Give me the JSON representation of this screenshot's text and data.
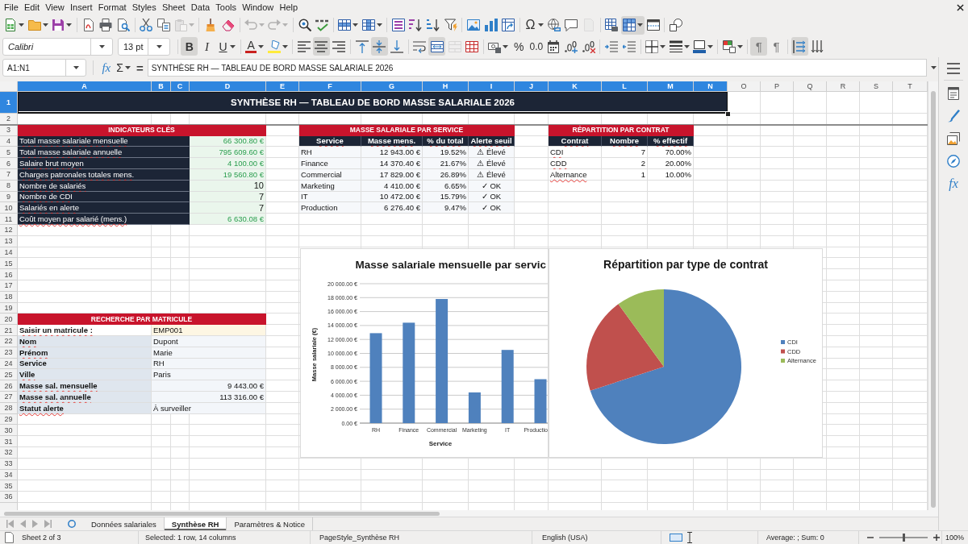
{
  "menu_bar": [
    "File",
    "Edit",
    "View",
    "Insert",
    "Format",
    "Styles",
    "Sheet",
    "Data",
    "Tools",
    "Window",
    "Help"
  ],
  "standard_toolbar": {
    "paste": {
      "disabled": true
    },
    "undo": {
      "disabled": true
    },
    "redo": {
      "disabled": true
    },
    "special_character": {
      "label": "Ω"
    },
    "header_footer": {
      "disabled": true
    },
    "freeze_cells": {
      "pressed": true
    }
  },
  "formatting_toolbar": {
    "font_name": "Calibri",
    "font_size": "13 pt",
    "bold": {
      "label": "B",
      "pressed": true
    },
    "italic": {
      "label": "I",
      "pressed": false
    },
    "underline": {
      "label": "U",
      "pressed": false
    },
    "font_color": {
      "label": "A"
    },
    "align_left": {
      "pressed": false
    },
    "align_center": {
      "pressed": true
    },
    "align_right": {
      "pressed": false
    },
    "align_top": {
      "pressed": false
    },
    "align_middle": {
      "pressed": true
    },
    "align_bottom": {
      "pressed": false
    },
    "wrap_text": {
      "pressed": false
    },
    "merge_center": {
      "pressed": true
    },
    "merge_cells": {
      "disabled": true
    },
    "percent": {
      "label": "%"
    },
    "number": {
      "label": "0.0"
    },
    "ltr": {
      "label": "¶",
      "pressed": true
    },
    "rtl": {
      "label": "¶",
      "pressed": false
    },
    "text_ltr": {
      "pressed": true
    },
    "text_ttb": {
      "pressed": false
    }
  },
  "formula_bar": {
    "name_box": "A1:N1",
    "function_wizard": "fx",
    "sum": "Σ",
    "equals": "=",
    "formula": "SYNTHÈSE RH — TABLEAU DE BORD MASSE SALARIALE 2026"
  },
  "sidebar": {
    "functions": "fx"
  },
  "sheet": {
    "column_headers": [
      {
        "label": "A",
        "selected": true
      },
      {
        "label": "B",
        "selected": true
      },
      {
        "label": "C",
        "selected": true
      },
      {
        "label": "D",
        "selected": true
      },
      {
        "label": "E",
        "selected": true
      },
      {
        "label": "F",
        "selected": true
      },
      {
        "label": "G",
        "selected": true
      },
      {
        "label": "H",
        "selected": true
      },
      {
        "label": "I",
        "selected": true
      },
      {
        "label": "J",
        "selected": true
      },
      {
        "label": "K",
        "selected": true
      },
      {
        "label": "L",
        "selected": true
      },
      {
        "label": "M",
        "selected": true
      },
      {
        "label": "N",
        "selected": true
      },
      {
        "label": "O",
        "selected": false
      },
      {
        "label": "P",
        "selected": false
      },
      {
        "label": "Q",
        "selected": false
      },
      {
        "label": "R",
        "selected": false
      },
      {
        "label": "S",
        "selected": false
      },
      {
        "label": "T",
        "selected": false
      }
    ],
    "row_headers": [
      {
        "label": "1",
        "selected": true
      },
      {
        "label": "2",
        "selected": false
      },
      {
        "label": "3",
        "selected": false
      },
      {
        "label": "4",
        "selected": false
      },
      {
        "label": "5",
        "selected": false
      },
      {
        "label": "6",
        "selected": false
      },
      {
        "label": "7",
        "selected": false
      },
      {
        "label": "8",
        "selected": false
      },
      {
        "label": "9",
        "selected": false
      },
      {
        "label": "10",
        "selected": false
      },
      {
        "label": "11",
        "selected": false
      },
      {
        "label": "12",
        "selected": false
      },
      {
        "label": "13",
        "selected": false
      },
      {
        "label": "14",
        "selected": false
      },
      {
        "label": "15",
        "selected": false
      },
      {
        "label": "16",
        "selected": false
      },
      {
        "label": "17",
        "selected": false
      },
      {
        "label": "18",
        "selected": false
      },
      {
        "label": "19",
        "selected": false
      },
      {
        "label": "20",
        "selected": false
      },
      {
        "label": "21",
        "selected": false
      },
      {
        "label": "22",
        "selected": false
      },
      {
        "label": "23",
        "selected": false
      },
      {
        "label": "24",
        "selected": false
      },
      {
        "label": "25",
        "selected": false
      },
      {
        "label": "26",
        "selected": false
      },
      {
        "label": "27",
        "selected": false
      },
      {
        "label": "28",
        "selected": false
      },
      {
        "label": "29",
        "selected": false
      },
      {
        "label": "30",
        "selected": false
      },
      {
        "label": "31",
        "selected": false
      },
      {
        "label": "32",
        "selected": false
      },
      {
        "label": "33",
        "selected": false
      },
      {
        "label": "34",
        "selected": false
      },
      {
        "label": "35",
        "selected": false
      },
      {
        "label": "36",
        "selected": false
      }
    ],
    "title": {
      "text": "SYNTHÈSE RH — TABLEAU DE BORD MASSE SALARIALE 2026",
      "selected": true
    },
    "key_indicators": {
      "title": "INDICATEURS CLÉS",
      "rows": [
        {
          "label": "Total masse salariale mensuelle",
          "value": "66 300.80 €",
          "kind": "currency",
          "misspelled": true
        },
        {
          "label": "Total masse salariale annuelle",
          "value": "795 609.60 €",
          "kind": "currency",
          "misspelled": true
        },
        {
          "label": "Salaire brut moyen",
          "value": "4 100.00 €",
          "kind": "currency",
          "misspelled": true
        },
        {
          "label": "Charges patronales totales mens.",
          "value": "19 560.80 €",
          "kind": "currency",
          "misspelled": true
        },
        {
          "label": "Nombre de salariés",
          "value": "10",
          "kind": "count",
          "misspelled": true
        },
        {
          "label": "Nombre de CDI",
          "value": "7",
          "kind": "count",
          "misspelled": true
        },
        {
          "label": "Salariés en alerte",
          "value": "7",
          "kind": "count",
          "misspelled": true
        },
        {
          "label": "Coût moyen par salarié (mens.)",
          "value": "6 630.08 €",
          "kind": "currency",
          "misspelled": true
        }
      ]
    },
    "service_table": {
      "title": "MASSE SALARIALE PAR SERVICE",
      "columns": [
        {
          "label": "Service",
          "misspelled": true
        },
        {
          "label": "Masse mens.",
          "misspelled": true
        },
        {
          "label": "% du total",
          "misspelled": true
        },
        {
          "label": "Alerte seuil",
          "misspelled": true
        }
      ],
      "rows": [
        {
          "cells": [
            "RH",
            "12 943.00 €",
            "19.52%",
            "⚠ Élevé"
          ]
        },
        {
          "cells": [
            "Finance",
            "14 370.40 €",
            "21.67%",
            "⚠ Élevé"
          ]
        },
        {
          "cells": [
            "Commercial",
            "17 829.00 €",
            "26.89%",
            "⚠ Élevé"
          ]
        },
        {
          "cells": [
            "Marketing",
            "4 410.00 €",
            "6.65%",
            "✓ OK"
          ]
        },
        {
          "cells": [
            "IT",
            "10 472.00 €",
            "15.79%",
            "✓ OK"
          ]
        },
        {
          "cells": [
            "Production",
            "6 276.40 €",
            "9.47%",
            "✓ OK"
          ]
        }
      ]
    },
    "contract_table": {
      "title": "RÉPARTITION PAR CONTRAT",
      "columns": [
        {
          "label": "Contrat",
          "misspelled": true
        },
        {
          "label": "Nombre",
          "misspelled": true
        },
        {
          "label": "% effectif",
          "misspelled": true
        }
      ],
      "rows": [
        {
          "cells": [
            "CDI",
            "7",
            "70.00%"
          ],
          "misspelled": true
        },
        {
          "cells": [
            "CDD",
            "2",
            "20.00%"
          ],
          "misspelled": true
        },
        {
          "cells": [
            "Alternance",
            "1",
            "10.00%"
          ],
          "misspelled": true
        }
      ]
    },
    "lookup": {
      "title": "RECHERCHE PAR MATRICULE",
      "input": {
        "label": "Saisir un matricule :",
        "value": "EMP001",
        "misspelled": true
      },
      "fields": [
        {
          "label": "Nom",
          "value": "Dupont",
          "kind": "text",
          "misspelled": true
        },
        {
          "label": "Prénom",
          "value": "Marie",
          "kind": "text",
          "misspelled": true
        },
        {
          "label": "Service",
          "value": "RH",
          "kind": "text",
          "misspelled": false
        },
        {
          "label": "Ville",
          "value": "Paris",
          "kind": "text",
          "misspelled": true
        },
        {
          "label": "Masse sal. mensuelle",
          "value": "9 443.00 €",
          "kind": "amount",
          "misspelled": true
        },
        {
          "label": "Masse sal. annuelle",
          "value": "113 316.00 €",
          "kind": "amount",
          "misspelled": true
        },
        {
          "label": "Statut alerte",
          "value": "À surveiller",
          "kind": "text",
          "misspelled": true
        }
      ]
    },
    "charts": [
      {
        "chart_data": {
          "type": "bar",
          "title": "Masse salariale mensuelle par servic",
          "xlabel": "Service",
          "ylabel": "Masse salariale (€)",
          "categories": [
            "RH",
            "Finance",
            "Commercial",
            "Marketing",
            "IT",
            "Productio"
          ],
          "series": [
            {
              "color": "#4f81bd",
              "values": [
                12900,
                14400,
                17800,
                4400,
                10500,
                6300
              ]
            }
          ],
          "ylim": [
            0,
            20000
          ],
          "yticks": [
            {
              "value": 0,
              "label": "0.00 €"
            },
            {
              "value": 2000,
              "label": "2 000.00 €"
            },
            {
              "value": 4000,
              "label": "4 000.00 €"
            },
            {
              "value": 6000,
              "label": "6 000.00 €"
            },
            {
              "value": 8000,
              "label": "8 000.00 €"
            },
            {
              "value": 10000,
              "label": "10 000.00 €"
            },
            {
              "value": 12000,
              "label": "12 000.00 €"
            },
            {
              "value": 14000,
              "label": "14 000.00 €"
            },
            {
              "value": 16000,
              "label": "16 000.00 €"
            },
            {
              "value": 18000,
              "label": "18 000.00 €"
            },
            {
              "value": 20000,
              "label": "20 000.00 €"
            }
          ],
          "grid": true
        }
      },
      {
        "chart_data": {
          "type": "pie",
          "title": "Répartition par type de contrat",
          "categories": [
            "CDI",
            "CDD",
            "Alternance"
          ],
          "values": [
            70,
            20,
            10
          ],
          "colors": [
            "#4f81bd",
            "#c0504d",
            "#9bbb59"
          ],
          "legend": "right"
        }
      }
    ]
  },
  "sheet_tabs": [
    {
      "label": "Données salariales",
      "selected": false
    },
    {
      "label": "Synthèse RH",
      "selected": true
    },
    {
      "label": "Paramètres & Notice",
      "selected": false
    }
  ],
  "status_bar": {
    "sheet": "Sheet 2 of 3",
    "selection": "Selected: 1 row, 14 columns",
    "page_style": "PageStyle_Synthèse RH",
    "language": "English (USA)",
    "summary": "Average: ; Sum: 0",
    "zoom_slider": {
      "level": 0.5
    },
    "zoom": "100%"
  }
}
